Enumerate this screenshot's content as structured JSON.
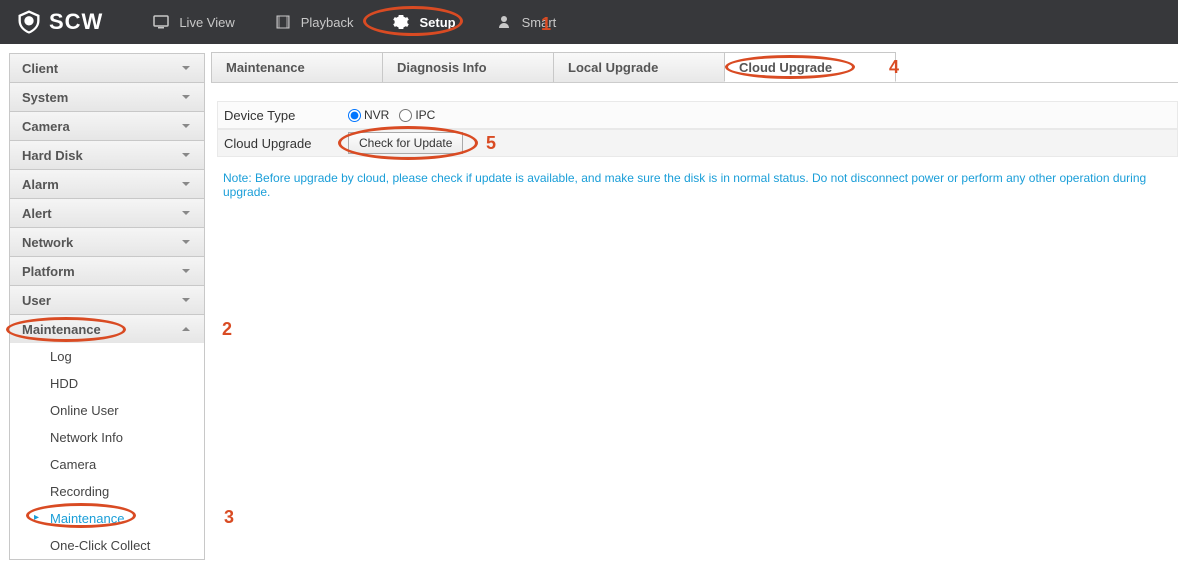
{
  "logo_text": "SCW",
  "nav": [
    {
      "label": "Live View"
    },
    {
      "label": "Playback"
    },
    {
      "label": "Setup",
      "active": true
    },
    {
      "label": "Smart"
    }
  ],
  "sidebar": {
    "groups": [
      {
        "label": "Client",
        "expanded": false
      },
      {
        "label": "System",
        "expanded": false
      },
      {
        "label": "Camera",
        "expanded": false
      },
      {
        "label": "Hard Disk",
        "expanded": false
      },
      {
        "label": "Alarm",
        "expanded": false
      },
      {
        "label": "Alert",
        "expanded": false
      },
      {
        "label": "Network",
        "expanded": false
      },
      {
        "label": "Platform",
        "expanded": false
      },
      {
        "label": "User",
        "expanded": false
      },
      {
        "label": "Maintenance",
        "expanded": true
      }
    ],
    "maintenance_items": [
      {
        "label": "Log"
      },
      {
        "label": "HDD"
      },
      {
        "label": "Online User"
      },
      {
        "label": "Network Info"
      },
      {
        "label": "Camera"
      },
      {
        "label": "Recording"
      },
      {
        "label": "Maintenance",
        "active": true
      },
      {
        "label": "One-Click Collect"
      }
    ]
  },
  "tabs": [
    {
      "label": "Maintenance"
    },
    {
      "label": "Diagnosis Info"
    },
    {
      "label": "Local Upgrade"
    },
    {
      "label": "Cloud Upgrade",
      "active": true
    }
  ],
  "form": {
    "device_type_label": "Device Type",
    "device_type_options": [
      {
        "label": "NVR",
        "checked": true
      },
      {
        "label": "IPC",
        "checked": false
      }
    ],
    "cloud_upgrade_label": "Cloud Upgrade",
    "check_button": "Check for Update",
    "note": "Note: Before upgrade by cloud, please check if update is available, and make sure the disk is in normal status. Do not disconnect power or perform any other operation during upgrade."
  },
  "annotations": {
    "1": "1",
    "2": "2",
    "3": "3",
    "4": "4",
    "5": "5"
  }
}
